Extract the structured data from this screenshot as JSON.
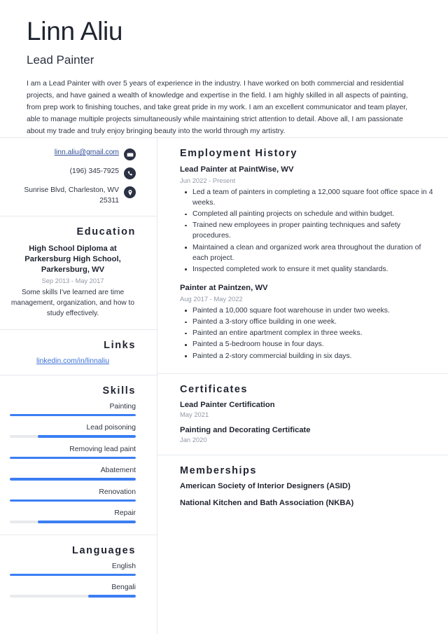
{
  "header": {
    "name": "Linn Aliu",
    "job_title": "Lead Painter",
    "summary": "I am a Lead Painter with over 5 years of experience in the industry. I have worked on both commercial and residential projects, and have gained a wealth of knowledge and expertise in the field. I am highly skilled in all aspects of painting, from prep work to finishing touches, and take great pride in my work. I am an excellent communicator and team player, able to manage multiple projects simultaneously while maintaining strict attention to detail. Above all, I am passionate about my trade and truly enjoy bringing beauty into the world through my artistry."
  },
  "colors": {
    "accent_blue": "#3b7ef3",
    "link_blue": "#3b70d6",
    "email_link": "#2f4d96",
    "icon_circle": "#2b3244",
    "heading": "#1f2430",
    "muted": "#9299a6",
    "track_gray": "#e8eaee",
    "divider": "#e7e9ee"
  },
  "contact": {
    "email": "linn.aliu@gmail.com",
    "email_icon": "envelope-icon",
    "phone": "(196) 345-7925",
    "phone_icon": "phone-icon",
    "address": "Sunrise Blvd, Charleston, WV 25311",
    "address_icon": "location-pin-icon"
  },
  "education": {
    "heading": "Education",
    "entries": [
      {
        "degree": "High School Diploma at Parkersburg High School, Parkersburg, WV",
        "date": "Sep 2013 - May 2017",
        "description": "Some skills I've learned are time management, organization, and how to study effectively."
      }
    ]
  },
  "links": {
    "heading": "Links",
    "items": [
      {
        "label": "linkedin.com/in/linnaliu"
      }
    ]
  },
  "skills": {
    "heading": "Skills",
    "items": [
      {
        "label": "Painting",
        "level": 100
      },
      {
        "label": "Lead poisoning",
        "level": 78
      },
      {
        "label": "Removing lead paint",
        "level": 100
      },
      {
        "label": "Abatement",
        "level": 100
      },
      {
        "label": "Renovation",
        "level": 100
      },
      {
        "label": "Repair",
        "level": 78
      }
    ]
  },
  "languages": {
    "heading": "Languages",
    "items": [
      {
        "label": "English",
        "level": 100
      },
      {
        "label": "Bengali",
        "level": 38
      }
    ]
  },
  "employment": {
    "heading": "Employment History",
    "entries": [
      {
        "title": "Lead Painter at PaintWise, WV",
        "date": "Jun 2022 - Present",
        "bullets": [
          "Led a team of painters in completing a 12,000 square foot office space in 4 weeks.",
          "Completed all painting projects on schedule and within budget.",
          "Trained new employees in proper painting techniques and safety procedures.",
          "Maintained a clean and organized work area throughout the duration of each project.",
          "Inspected completed work to ensure it met quality standards."
        ]
      },
      {
        "title": "Painter at Paintzen, WV",
        "date": "Aug 2017 - May 2022",
        "bullets": [
          "Painted a 10,000 square foot warehouse in under two weeks.",
          "Painted a 3-story office building in one week.",
          "Painted an entire apartment complex in three weeks.",
          "Painted a 5-bedroom house in four days.",
          "Painted a 2-story commercial building in six days."
        ]
      }
    ]
  },
  "certificates": {
    "heading": "Certificates",
    "items": [
      {
        "name": "Lead Painter Certification",
        "date": "May 2021"
      },
      {
        "name": "Painting and Decorating Certificate",
        "date": "Jan 2020"
      }
    ]
  },
  "memberships": {
    "heading": "Memberships",
    "items": [
      {
        "name": "American Society of Interior Designers (ASID)"
      },
      {
        "name": "National Kitchen and Bath Association (NKBA)"
      }
    ]
  }
}
